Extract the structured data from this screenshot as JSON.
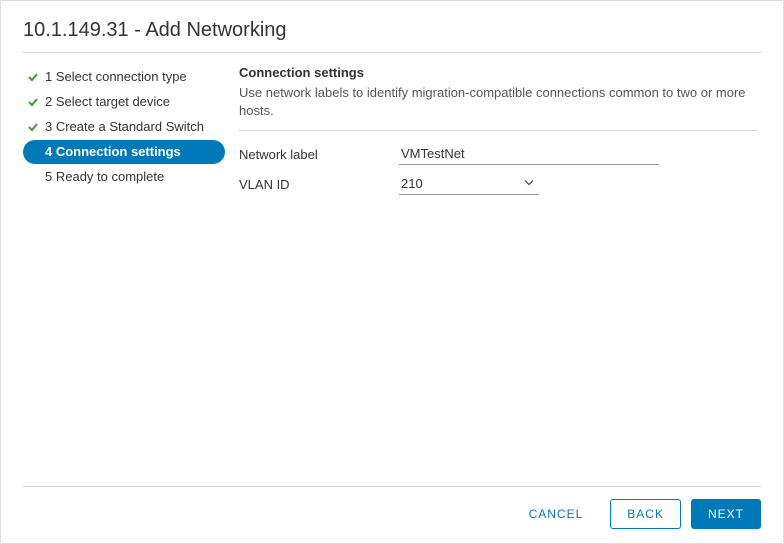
{
  "title": "10.1.149.31 - Add Networking",
  "steps": [
    {
      "label": "1 Select connection type"
    },
    {
      "label": "2 Select target device"
    },
    {
      "label": "3 Create a Standard Switch"
    },
    {
      "label": "4 Connection settings"
    },
    {
      "label": "5 Ready to complete"
    }
  ],
  "section": {
    "title": "Connection settings",
    "description": "Use network labels to identify migration-compatible connections common to two or more hosts."
  },
  "form": {
    "network_label": {
      "label": "Network label",
      "value": "VMTestNet"
    },
    "vlan_id": {
      "label": "VLAN ID",
      "value": "210"
    }
  },
  "actions": {
    "cancel": "CANCEL",
    "back": "BACK",
    "next": "NEXT"
  }
}
